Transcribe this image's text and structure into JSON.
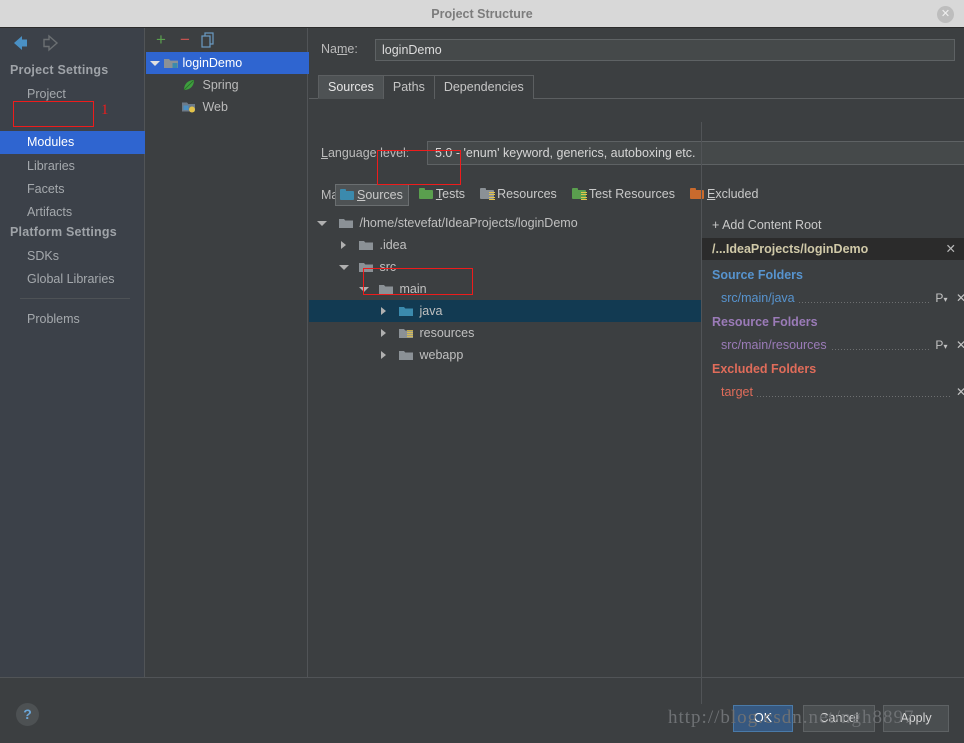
{
  "window": {
    "title": "Project Structure",
    "close_label": "✕"
  },
  "sidebar": {
    "nav": {
      "back_icon": "back-arrow",
      "forward_icon": "forward-arrow"
    },
    "sections": [
      {
        "label": "Project Settings"
      },
      {
        "label": "Platform Settings"
      }
    ],
    "project_settings_items": [
      {
        "label": "Project",
        "selected": false
      },
      {
        "label": "Modules",
        "selected": true
      },
      {
        "label": "Libraries",
        "selected": false
      },
      {
        "label": "Facets",
        "selected": false
      },
      {
        "label": "Artifacts",
        "selected": false
      }
    ],
    "platform_settings_items": [
      {
        "label": "SDKs",
        "selected": false
      },
      {
        "label": "Global Libraries",
        "selected": false
      }
    ],
    "problems_item": {
      "label": "Problems"
    },
    "annotation_number": "1"
  },
  "modules_panel": {
    "toolbar": [
      {
        "name": "add-module-button",
        "glyph": "+",
        "color": "#5a9f4e"
      },
      {
        "name": "remove-module-button",
        "glyph": "−",
        "color": "#c75450"
      },
      {
        "name": "copy-module-button",
        "glyph": "❐",
        "color": "#6a9bc3"
      }
    ],
    "tree": [
      {
        "label": "loginDemo",
        "level": 0,
        "expanded": true,
        "selected": true,
        "icon": "module-icon"
      },
      {
        "label": "Spring",
        "level": 1,
        "expanded": null,
        "selected": false,
        "icon": "spring-leaf-icon"
      },
      {
        "label": "Web",
        "level": 1,
        "expanded": null,
        "selected": false,
        "icon": "web-facet-icon"
      }
    ]
  },
  "main": {
    "name_label": "Name:",
    "name_value": "loginDemo",
    "tabs": [
      {
        "label": "Sources",
        "active": true
      },
      {
        "label": "Paths",
        "active": false
      },
      {
        "label": "Dependencies",
        "active": false
      }
    ],
    "language_level_label": "Language level:",
    "language_level_value": "5.0 - 'enum' keyword, generics, autoboxing etc.",
    "mark_as_label": "Mark as:",
    "mark_as_buttons": [
      {
        "label": "Sources",
        "active": true,
        "color": "#3b8aad",
        "kind": "plain"
      },
      {
        "label": "Tests",
        "active": false,
        "color": "#5a9f4e",
        "kind": "plain"
      },
      {
        "label": "Resources",
        "active": false,
        "color": "#8b9196",
        "kind": "lined"
      },
      {
        "label": "Test Resources",
        "active": false,
        "color": "#5a9f4e",
        "kind": "lined"
      },
      {
        "label": "Excluded",
        "active": false,
        "color": "#c96a2d",
        "kind": "plain"
      }
    ],
    "file_tree": [
      {
        "label": "/home/stevefat/IdeaProjects/loginDemo",
        "level": 0,
        "expanded": true,
        "selected": false,
        "icon": "folder-gray-icon"
      },
      {
        "label": ".idea",
        "level": 1,
        "expanded": false,
        "selected": false,
        "icon": "folder-gray-icon"
      },
      {
        "label": "src",
        "level": 1,
        "expanded": true,
        "selected": false,
        "icon": "folder-gray-icon"
      },
      {
        "label": "main",
        "level": 2,
        "expanded": true,
        "selected": false,
        "icon": "folder-gray-icon"
      },
      {
        "label": "java",
        "level": 3,
        "expanded": false,
        "selected": true,
        "icon": "folder-source-icon"
      },
      {
        "label": "resources",
        "level": 3,
        "expanded": false,
        "selected": false,
        "icon": "folder-resource-icon"
      },
      {
        "label": "webapp",
        "level": 3,
        "expanded": false,
        "selected": false,
        "icon": "folder-gray-icon"
      }
    ]
  },
  "content_roots": {
    "add_content_root_label": "+ Add Content Root",
    "root_path": "/...IdeaProjects/loginDemo",
    "root_close_label": "✕",
    "groups": [
      {
        "title": "Source Folders",
        "color": "#5794cf",
        "rows": [
          {
            "path": "src/main/java",
            "color": "#5794cf",
            "has_package_prefix": true,
            "remove_label": "✕"
          }
        ]
      },
      {
        "title": "Resource Folders",
        "color": "#9b7bb8",
        "rows": [
          {
            "path": "src/main/resources",
            "color": "#9b7bb8",
            "has_package_prefix": true,
            "remove_label": "✕"
          }
        ]
      },
      {
        "title": "Excluded Folders",
        "color": "#e06c5a",
        "rows": [
          {
            "path": "target",
            "color": "#e06c5a",
            "has_package_prefix": false,
            "remove_label": "✕"
          }
        ]
      }
    ]
  },
  "footer": {
    "help_label": "?",
    "buttons": [
      {
        "label": "OK",
        "primary": true
      },
      {
        "label": "Cancel",
        "primary": false
      },
      {
        "label": "Apply",
        "primary": false
      }
    ],
    "watermark": "http://blog.csdn.net/ngh8897"
  }
}
